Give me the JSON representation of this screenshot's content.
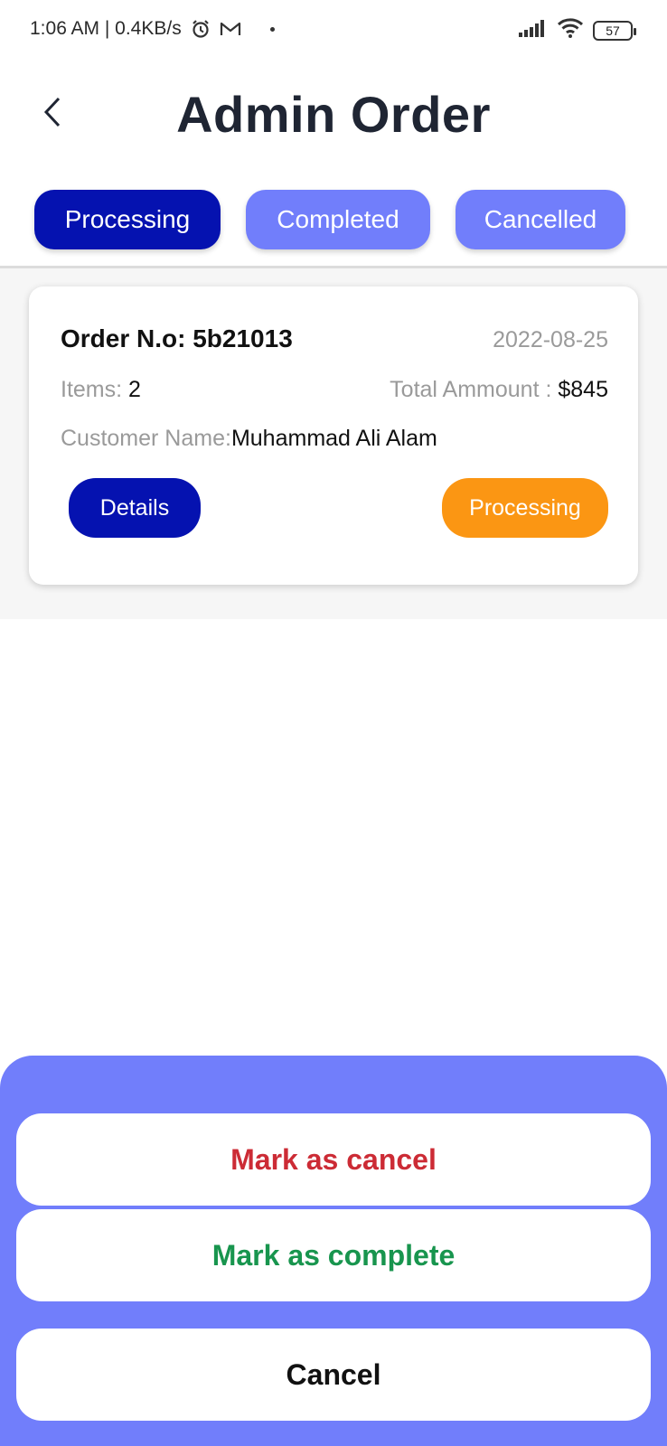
{
  "status_bar": {
    "time_speed": "1:06 AM | 0.4KB/s",
    "battery": "57"
  },
  "header": {
    "title": "Admin Order"
  },
  "tabs": [
    {
      "label": "Processing",
      "active": true
    },
    {
      "label": "Completed",
      "active": false
    },
    {
      "label": "Cancelled",
      "active": false
    }
  ],
  "order": {
    "number_label": "Order N.o: 5b21013",
    "date": "2022-08-25",
    "items_label": "Items: ",
    "items_value": "2",
    "total_label": "Total Ammount : ",
    "total_value": "$845",
    "customer_label": "Customer Name: ",
    "customer_value": "Muhammad Ali Alam",
    "details_label": "Details",
    "status_label": "Processing"
  },
  "sheet": {
    "mark_cancel": "Mark as cancel",
    "mark_complete": "Mark as complete",
    "cancel": "Cancel"
  },
  "colors": {
    "primary": "#0512b0",
    "accent": "#717efb",
    "processing": "#fb9613",
    "danger": "#cc2b35",
    "success": "#18954e"
  }
}
